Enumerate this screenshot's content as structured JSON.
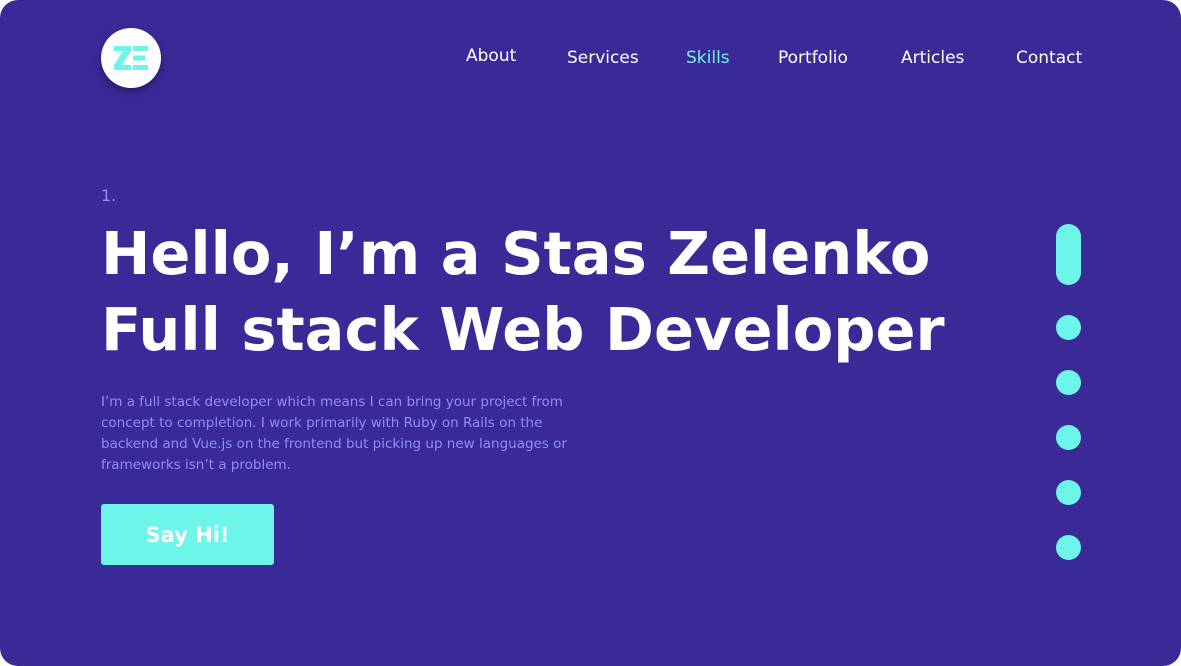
{
  "colors": {
    "background": "#392a98",
    "accent": "#6ef5ea",
    "muted_text": "#8f8ff5",
    "text": "#ffffff"
  },
  "logo": {
    "icon": "ze-monogram-logo",
    "text": "ZE"
  },
  "nav": {
    "items": [
      {
        "label": "About"
      },
      {
        "label": "Services"
      },
      {
        "label": "Skills",
        "active": true
      },
      {
        "label": "Portfolio"
      },
      {
        "label": "Articles"
      },
      {
        "label": "Contact"
      }
    ]
  },
  "hero": {
    "section_number": "1.",
    "title_line1": "Hello, I’m a Stas Zelenko",
    "title_line2": "Full stack Web Developer",
    "description": "I’m a full stack developer which means I can bring your project from concept to completion. I work primarily with Ruby on Rails on the backend and Vue.js on the frontend but picking up new languages or frameworks isn’t a problem.",
    "cta_label": "Say Hi!"
  },
  "pager": {
    "total": 6,
    "active_index": 0
  }
}
